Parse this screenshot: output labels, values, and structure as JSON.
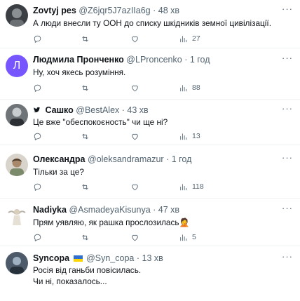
{
  "tweets": [
    {
      "name": "Zovtyj pes",
      "handle": "@Z6jqr5J7azIIa6g",
      "sep": "·",
      "time": "48 хв",
      "text": [
        "А люди внесли ту  ООН до списку шкідників земної цивілізації."
      ],
      "views": "27",
      "avatar": "avatar-icon-image-dark"
    },
    {
      "name": "Людмила Пронченко",
      "handle": "@LProncenko",
      "sep": "·",
      "time": "1 год",
      "text": [
        "Ну, хоч якесь розуміння."
      ],
      "views": "88",
      "avatar_letter": "Л"
    },
    {
      "name": "Сашко",
      "handle": "@BestAlex",
      "sep": "·",
      "time": "43 хв",
      "text": [
        "Це вже \"обеспокоєность\" чи ще ні?"
      ],
      "views": "13",
      "avatar": "avatar-icon-image-grey"
    },
    {
      "name": "Олександра",
      "handle": "@oleksandramazur",
      "sep": "·",
      "time": "1 год",
      "text": [
        "Тільки за це?"
      ],
      "views": "118",
      "avatar": "avatar-icon-image-light"
    },
    {
      "name": "Nadiyka",
      "handle": "@AsmadeyaKisunya",
      "sep": "·",
      "time": "47 хв",
      "text": [
        "Прям уявляю, як рашка прослозилась🤦"
      ],
      "views": "5",
      "avatar": "avatar-icon-image-angel"
    },
    {
      "name": "Syncopa",
      "handle": "@Syn_copa",
      "sep": "·",
      "time": "13 хв",
      "text": [
        "Росія від ганьби повісилась.",
        "Чи ні, показалось..."
      ],
      "views": "",
      "avatar": "avatar-icon-image-blue"
    }
  ],
  "more_label": "···",
  "colors": {
    "text_primary": "#0f1419",
    "text_secondary": "#536471",
    "divider": "#eff3f4",
    "letter_avatar_bg": "#7856ff",
    "flag_blue": "#2f6fd0",
    "flag_yellow": "#ffd500"
  },
  "icons": [
    "reply-icon",
    "retweet-icon",
    "like-icon",
    "views-icon",
    "more-icon",
    "twitter-bird-icon",
    "ukraine-flag-icon"
  ]
}
